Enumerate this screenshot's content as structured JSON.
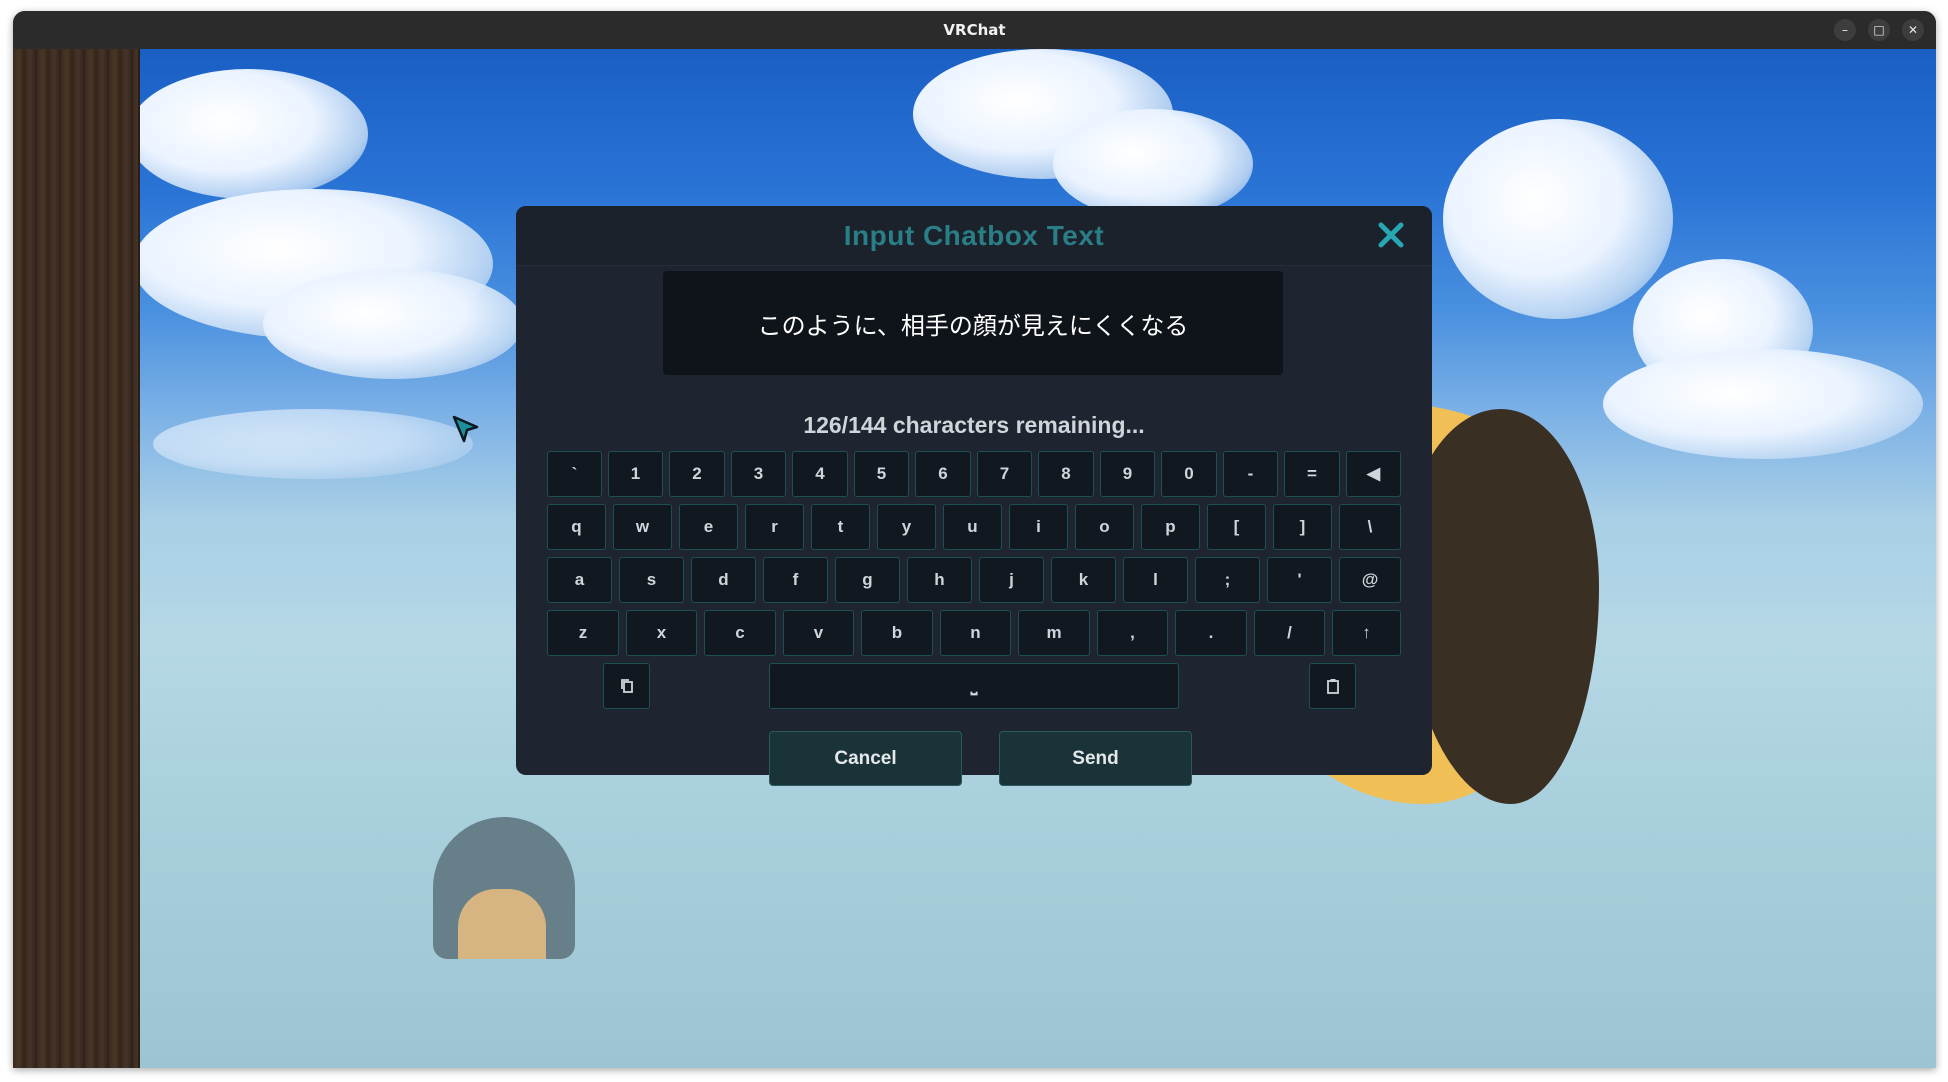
{
  "window": {
    "title": "VRChat",
    "controls": {
      "minimize": "–",
      "maximize": "□",
      "close": "✕"
    }
  },
  "dialog": {
    "title": "Input Chatbox Text",
    "input_text": "このように、相手の顔が見えにくくなる",
    "remaining": "126/144 characters remaining...",
    "keyboard": {
      "row1": [
        "`",
        "1",
        "2",
        "3",
        "4",
        "5",
        "6",
        "7",
        "8",
        "9",
        "0",
        "-",
        "=",
        "◀"
      ],
      "row2": [
        "q",
        "w",
        "e",
        "r",
        "t",
        "y",
        "u",
        "i",
        "o",
        "p",
        "[",
        "]",
        "\\"
      ],
      "row3": [
        "a",
        "s",
        "d",
        "f",
        "g",
        "h",
        "j",
        "k",
        "l",
        ";",
        "'",
        "@"
      ],
      "row4": [
        "z",
        "x",
        "c",
        "v",
        "b",
        "n",
        "m",
        ",",
        ".",
        "/",
        "↑"
      ],
      "space": "⎵",
      "copy_icon": "copy-icon",
      "paste_icon": "clipboard-icon"
    },
    "cancel_label": "Cancel",
    "send_label": "Send"
  },
  "colors": {
    "title_teal": "#2a7e85",
    "close_cyan": "#27a7b4",
    "key_border": "#1d5052",
    "dialog_bg": "#1e2530"
  }
}
